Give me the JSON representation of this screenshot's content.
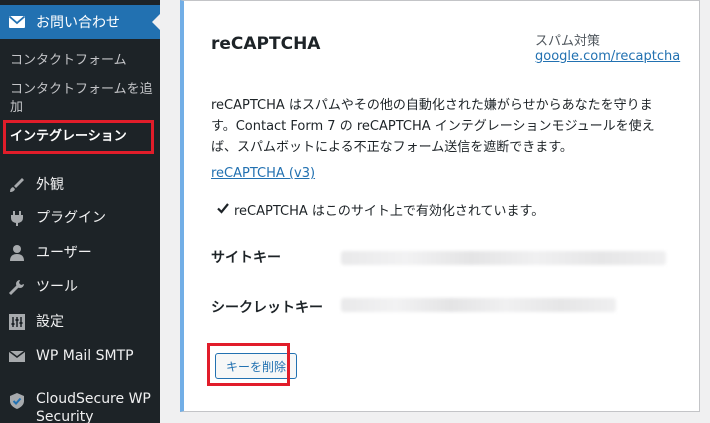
{
  "sidebar": {
    "parent": {
      "label": "お問い合わせ",
      "icon": "envelope-icon"
    },
    "submenu": [
      {
        "label": "コンタクトフォーム"
      },
      {
        "label": "コンタクトフォームを追加"
      },
      {
        "label": "インテグレーション",
        "active": true
      }
    ],
    "items": [
      {
        "label": "外観",
        "icon": "paintbrush-icon"
      },
      {
        "label": "プラグイン",
        "icon": "plugin-icon"
      },
      {
        "label": "ユーザー",
        "icon": "user-icon"
      },
      {
        "label": "ツール",
        "icon": "wrench-icon"
      },
      {
        "label": "設定",
        "icon": "settings-icon"
      },
      {
        "label": "WP Mail SMTP",
        "icon": "mail-smtp-icon"
      },
      {
        "label": "CloudSecure WP Security",
        "icon": "shield-check-icon"
      }
    ]
  },
  "card": {
    "title": "reCAPTCHA",
    "spam_label": "スパム対策",
    "google_link": "google.com/recaptcha",
    "description": "reCAPTCHA はスパムやその他の自動化された嫌がらせからあなたを守ります。Contact Form 7 の reCAPTCHA インテグレーションモジュールを使えば、スパムボットによる不正なフォーム送信を遮断できます。",
    "v3_link": "reCAPTCHA (v3)",
    "status": "reCAPTCHA はこのサイト上で有効化されています。",
    "site_key_label": "サイトキー",
    "secret_key_label": "シークレットキー",
    "delete_button": "キーを削除"
  },
  "colors": {
    "sidebar_bg": "#1d2327",
    "active_menu": "#2271b1",
    "highlight": "#e11d2a",
    "card_accent": "#72aee6",
    "link": "#2271b1"
  }
}
